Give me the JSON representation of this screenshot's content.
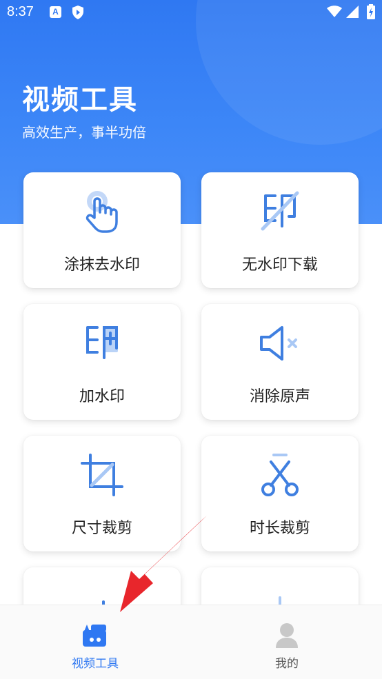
{
  "status_bar": {
    "time": "8:37",
    "app_icon_letter": "A"
  },
  "header": {
    "title": "视频工具",
    "subtitle": "高效生产，事半功倍"
  },
  "tools": [
    {
      "label": "涂抹去水印",
      "icon": "tap-finger-icon"
    },
    {
      "label": "无水印下载",
      "icon": "watermark-off-icon"
    },
    {
      "label": "加水印",
      "icon": "watermark-add-icon"
    },
    {
      "label": "消除原声",
      "icon": "mute-icon"
    },
    {
      "label": "尺寸裁剪",
      "icon": "crop-icon"
    },
    {
      "label": "时长裁剪",
      "icon": "scissors-icon"
    },
    {
      "label": "",
      "icon": "download-frame-icon"
    },
    {
      "label": "",
      "icon": "audio-split-icon"
    }
  ],
  "bottom_nav": [
    {
      "label": "视频工具",
      "icon": "video-tool-icon",
      "active": true
    },
    {
      "label": "我的",
      "icon": "user-icon",
      "active": false
    }
  ],
  "colors": {
    "accent": "#2f78f2",
    "icon_blue": "#3f7fe0",
    "icon_light": "#a9c8f5"
  }
}
